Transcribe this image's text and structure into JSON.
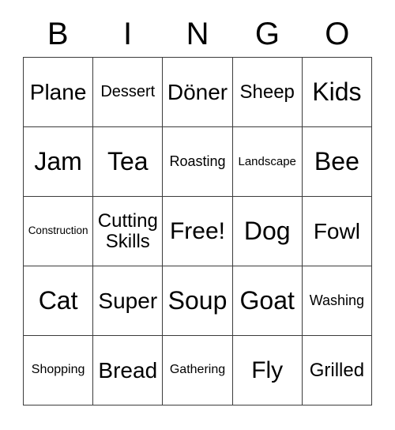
{
  "card": {
    "header": {
      "letters": [
        "B",
        "I",
        "N",
        "G",
        "O"
      ]
    },
    "colors": {
      "border": "#3c3c3c",
      "text": "#000000",
      "background": "#ffffff"
    },
    "rows": [
      {
        "cells": [
          {
            "label": "Plane",
            "size": "sz-lg"
          },
          {
            "label": "Dessert",
            "size": "sz-sm"
          },
          {
            "label": "Döner",
            "size": "sz-lg"
          },
          {
            "label": "Sheep",
            "size": "sz-md"
          },
          {
            "label": "Kids",
            "size": "sz-xxl"
          }
        ]
      },
      {
        "cells": [
          {
            "label": "Jam",
            "size": "sz-xxl"
          },
          {
            "label": "Tea",
            "size": "sz-xxl"
          },
          {
            "label": "Roasting",
            "size": "sz-xs"
          },
          {
            "label": "Landscape",
            "size": "sz-tny"
          },
          {
            "label": "Bee",
            "size": "sz-xxl"
          }
        ]
      },
      {
        "cells": [
          {
            "label": "Construction",
            "size": "sz-min"
          },
          {
            "label": "Cutting\nSkills",
            "size": "sz-md"
          },
          {
            "label": "Free!",
            "size": "sz-xl"
          },
          {
            "label": "Dog",
            "size": "sz-xxl"
          },
          {
            "label": "Fowl",
            "size": "sz-lg"
          }
        ]
      },
      {
        "cells": [
          {
            "label": "Cat",
            "size": "sz-xxl"
          },
          {
            "label": "Super",
            "size": "sz-lg"
          },
          {
            "label": "Soup",
            "size": "sz-xxl"
          },
          {
            "label": "Goat",
            "size": "sz-xxl"
          },
          {
            "label": "Washing",
            "size": "sz-xs"
          }
        ]
      },
      {
        "cells": [
          {
            "label": "Shopping",
            "size": "sz-xxs"
          },
          {
            "label": "Bread",
            "size": "sz-lg"
          },
          {
            "label": "Gathering",
            "size": "sz-xxs"
          },
          {
            "label": "Fly",
            "size": "sz-xl"
          },
          {
            "label": "Grilled",
            "size": "sz-md"
          }
        ]
      }
    ]
  }
}
